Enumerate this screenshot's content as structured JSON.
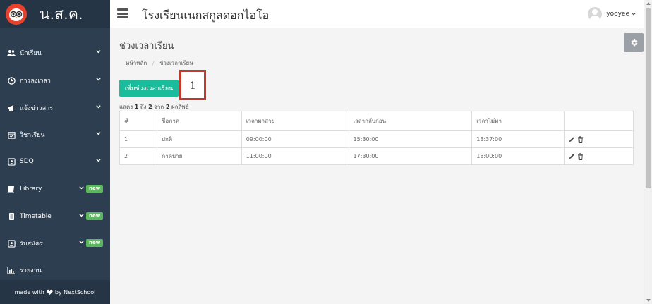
{
  "brand": {
    "name": "น.ส.ค."
  },
  "sidebar": {
    "items": [
      {
        "label": "นักเรียน",
        "icon": "users-icon",
        "badge": ""
      },
      {
        "label": "การลงเวลา",
        "icon": "clock-icon",
        "badge": ""
      },
      {
        "label": "แจ้งข่าวสาร",
        "icon": "megaphone-icon",
        "badge": ""
      },
      {
        "label": "วิชาเรียน",
        "icon": "calendar-check-icon",
        "badge": ""
      },
      {
        "label": "SDQ",
        "icon": "contact-card-icon",
        "badge": ""
      },
      {
        "label": "Library",
        "icon": "book-icon",
        "badge": "new"
      },
      {
        "label": "Timetable",
        "icon": "timetable-icon",
        "badge": "new"
      },
      {
        "label": "รับสมัคร",
        "icon": "id-card-icon",
        "badge": "new"
      },
      {
        "label": "รายงาน",
        "icon": "bar-chart-icon",
        "badge": ""
      }
    ],
    "footer": {
      "before": "made with",
      "after": "by NextSchool"
    }
  },
  "topbar": {
    "school_name": "โรงเรียนเนกสกูลดอกไอโอ",
    "username": "yooyee"
  },
  "page": {
    "title": "ช่วงเวลาเรียน",
    "breadcrumb": {
      "home": "หน้าหลัก",
      "separator": "/",
      "current": "ช่วงเวลาเรียน"
    },
    "add_button": "เพิ่มช่วงเวลาเรียน",
    "annotation_number": "1",
    "count": {
      "prefix": "แสดง",
      "from": "1",
      "to_word": "ถึง",
      "to": "2",
      "of_word": "จาก",
      "total": "2",
      "suffix": "ผลลัพธ์"
    }
  },
  "table": {
    "headers": [
      "#",
      "ชื่อภาค",
      "เวลามาสาย",
      "เวลากลับก่อน",
      "เวลาไม่มา",
      ""
    ],
    "rows": [
      [
        "1",
        "ปกติ",
        "09:00:00",
        "15:30:00",
        "13:37:00"
      ],
      [
        "2",
        "ภาคบ่าย",
        "11:00:00",
        "17:30:00",
        "18:00:00"
      ]
    ]
  },
  "colors": {
    "sidebar_bg": "#2c3e50",
    "accent_teal": "#1abc9c",
    "badge_green": "#5cb85c",
    "annotation_red": "#c0392b",
    "logo_red": "#e8412c"
  }
}
